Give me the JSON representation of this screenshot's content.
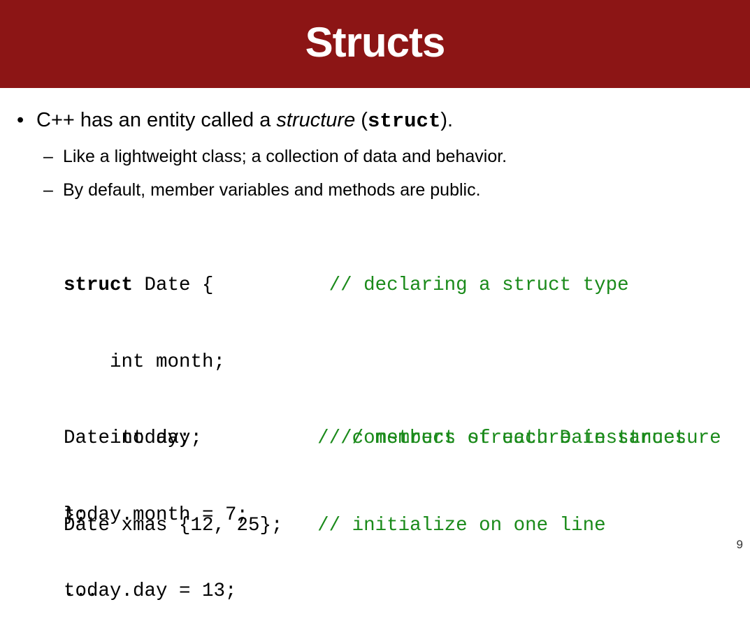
{
  "slide": {
    "title": "Structs",
    "page_number": "9"
  },
  "bullets": {
    "b1": {
      "marker": "•",
      "prefix": "C++ has an entity called a ",
      "emph": "structure",
      "mid": " (",
      "code": "struct",
      "suffix": ")."
    },
    "sub": [
      {
        "marker": "–",
        "text": "Like a lightweight class;  a collection of data and behavior."
      },
      {
        "marker": "–",
        "text": "By default, member variables and methods are public."
      }
    ]
  },
  "code": {
    "l1_kw": "struct",
    "l1_rest": " Date {          ",
    "l1_comment": "// declaring a struct type",
    "l2": "    int month;",
    "l3": "    int day;            ",
    "l3_comment": "// members of each Date structure",
    "l4": "};",
    "l5": "...",
    "l6": "Date today;           ",
    "l6_comment": "// construct structure instances",
    "l7": "today.month = 7;",
    "l8": "today.day = 13;",
    "l9": "Date xmas {12, 25};   ",
    "l9_comment": "// initialize on one line"
  },
  "colors": {
    "title_bar": "#8c1515",
    "comment": "#1a8a1a"
  }
}
